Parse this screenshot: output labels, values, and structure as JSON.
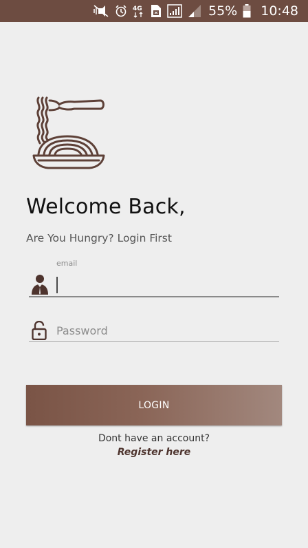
{
  "status_bar": {
    "battery_percent": "55%",
    "time": "10:48",
    "network_label": "4G",
    "icons": [
      "vibrate-mute-icon",
      "alarm-icon",
      "data-4g-icon",
      "sim-icon",
      "signal-icon",
      "signal-secondary-icon",
      "battery-icon"
    ]
  },
  "logo": {
    "icon": "noodle-bowl-fork-icon",
    "color": "#5d4037"
  },
  "header": {
    "title": "Welcome Back,",
    "subtitle": "Are You Hungry? Login First"
  },
  "form": {
    "email": {
      "label": "email",
      "value": "",
      "icon": "person-suit-icon"
    },
    "password": {
      "placeholder": "Password",
      "value": "",
      "icon": "unlock-icon"
    }
  },
  "login_button": {
    "label": "LOGIN"
  },
  "footer": {
    "prompt": "Dont have an account?",
    "register_link": "Register here"
  },
  "colors": {
    "primary": "#6d4c41",
    "accent_dark": "#4e342e",
    "background": "#eeeeee"
  }
}
